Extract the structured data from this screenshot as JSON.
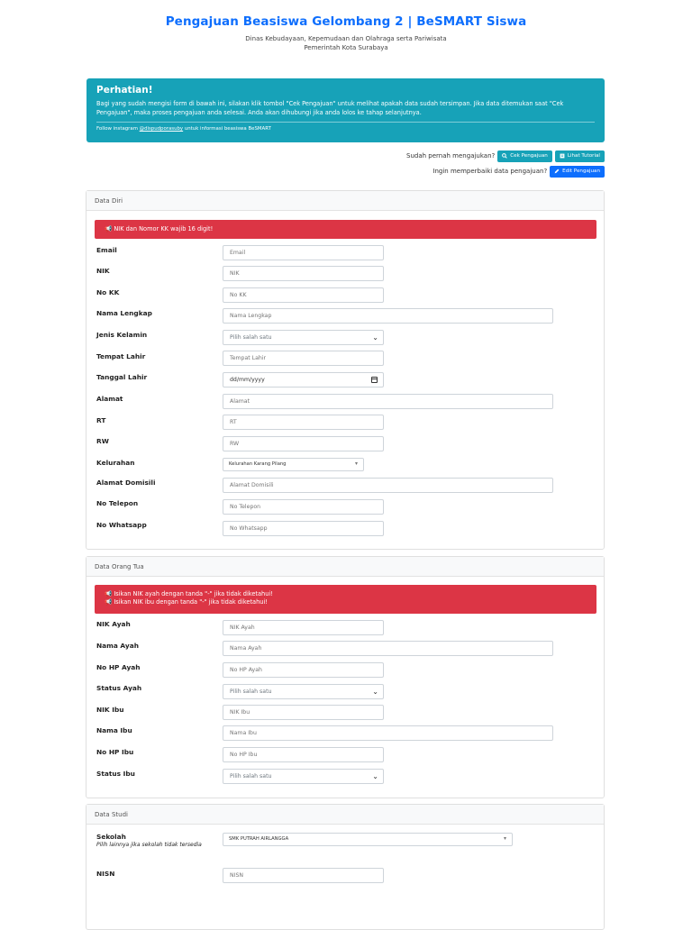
{
  "header": {
    "title": "Pengajuan Beasiswa Gelombang 2 | BeSMART Siswa",
    "subtitle_line1": "Dinas Kebudayaan, Kepemudaan dan Olahraga serta Pariwisata",
    "subtitle_line2": "Pemerintah Kota Surabaya"
  },
  "notice": {
    "heading": "Perhatian!",
    "body": "Bagi yang sudah mengisi form di bawah ini, silakan klik tombol \"Cek Pengajuan\" untuk melihat apakah data sudah tersimpan. Jika data ditemukan saat \"Cek Pengajuan\", maka proses pengajuan anda selesai. Anda akan dihubungi jika anda lolos ke tahap selanjutnya.",
    "follow_prefix": "Follow instagram ",
    "follow_handle": "@dispudporasuby",
    "follow_suffix": " untuk informasi beasiswa BeSMART"
  },
  "actions": {
    "question1": "Sudah pernah mengajukan?",
    "cek_label": "Cek Pengajuan",
    "tutorial_label": "Lihat Tutorial",
    "question2": "Ingin memperbaiki data pengajuan?",
    "edit_label": "Edit Pengajuan"
  },
  "data_diri": {
    "title": "Data Diri",
    "alert": "NIK dan Nomor KK wajib 16 digit!",
    "fields": {
      "email": {
        "label": "Email",
        "placeholder": "Email"
      },
      "nik": {
        "label": "NIK",
        "placeholder": "NIK"
      },
      "no_kk": {
        "label": "No KK",
        "placeholder": "No KK"
      },
      "nama": {
        "label": "Nama Lengkap",
        "placeholder": "Nama Lengkap"
      },
      "jenis_kelamin": {
        "label": "Jenis Kelamin",
        "value": "Pilih salah satu"
      },
      "tempat_lahir": {
        "label": "Tempat Lahir",
        "placeholder": "Tempat Lahir"
      },
      "tanggal_lahir": {
        "label": "Tanggal Lahir",
        "value": "dd/mm/yyyy"
      },
      "alamat": {
        "label": "Alamat",
        "placeholder": "Alamat"
      },
      "rt": {
        "label": "RT",
        "placeholder": "RT"
      },
      "rw": {
        "label": "RW",
        "placeholder": "RW"
      },
      "kelurahan": {
        "label": "Kelurahan",
        "value": "Kelurahan Karang Pilang"
      },
      "alamat_domisili": {
        "label": "Alamat Domisili",
        "placeholder": "Alamat Domisili"
      },
      "no_telepon": {
        "label": "No Telepon",
        "placeholder": "No Telepon"
      },
      "no_whatsapp": {
        "label": "No Whatsapp",
        "placeholder": "No Whatsapp"
      }
    }
  },
  "data_ortu": {
    "title": "Data Orang Tua",
    "alert_line1": "Isikan NIK ayah dengan tanda \"-\" jika tidak diketahui!",
    "alert_line2": "Isikan NIK ibu dengan tanda \"-\" jika tidak diketahui!",
    "fields": {
      "nik_ayah": {
        "label": "NIK Ayah",
        "placeholder": "NIK Ayah"
      },
      "nama_ayah": {
        "label": "Nama Ayah",
        "placeholder": "Nama Ayah"
      },
      "hp_ayah": {
        "label": "No HP Ayah",
        "placeholder": "No HP Ayah"
      },
      "status_ayah": {
        "label": "Status Ayah",
        "value": "Pilih salah satu"
      },
      "nik_ibu": {
        "label": "NIK Ibu",
        "placeholder": "NIK Ibu"
      },
      "nama_ibu": {
        "label": "Nama Ibu",
        "placeholder": "Nama Ibu"
      },
      "hp_ibu": {
        "label": "No HP Ibu",
        "placeholder": "No HP Ibu"
      },
      "status_ibu": {
        "label": "Status Ibu",
        "value": "Pilih salah satu"
      }
    }
  },
  "data_studi": {
    "title": "Data Studi",
    "fields": {
      "sekolah": {
        "label": "Sekolah",
        "hint": "Pilih lainnya jika sekolah tidak tersedia",
        "value": "SMK PUTRAH AIRLANGGA"
      },
      "nisn": {
        "label": "NISN",
        "placeholder": "NISN"
      }
    }
  },
  "colors": {
    "primary": "#0d6efd",
    "info": "#17a2b8",
    "danger": "#dc3545"
  },
  "icons": {
    "megaphone": "megaphone-icon",
    "search": "search-icon",
    "book": "book-icon",
    "pencil": "pencil-icon",
    "chevron": "chevron-down-icon",
    "calendar": "calendar-icon"
  }
}
